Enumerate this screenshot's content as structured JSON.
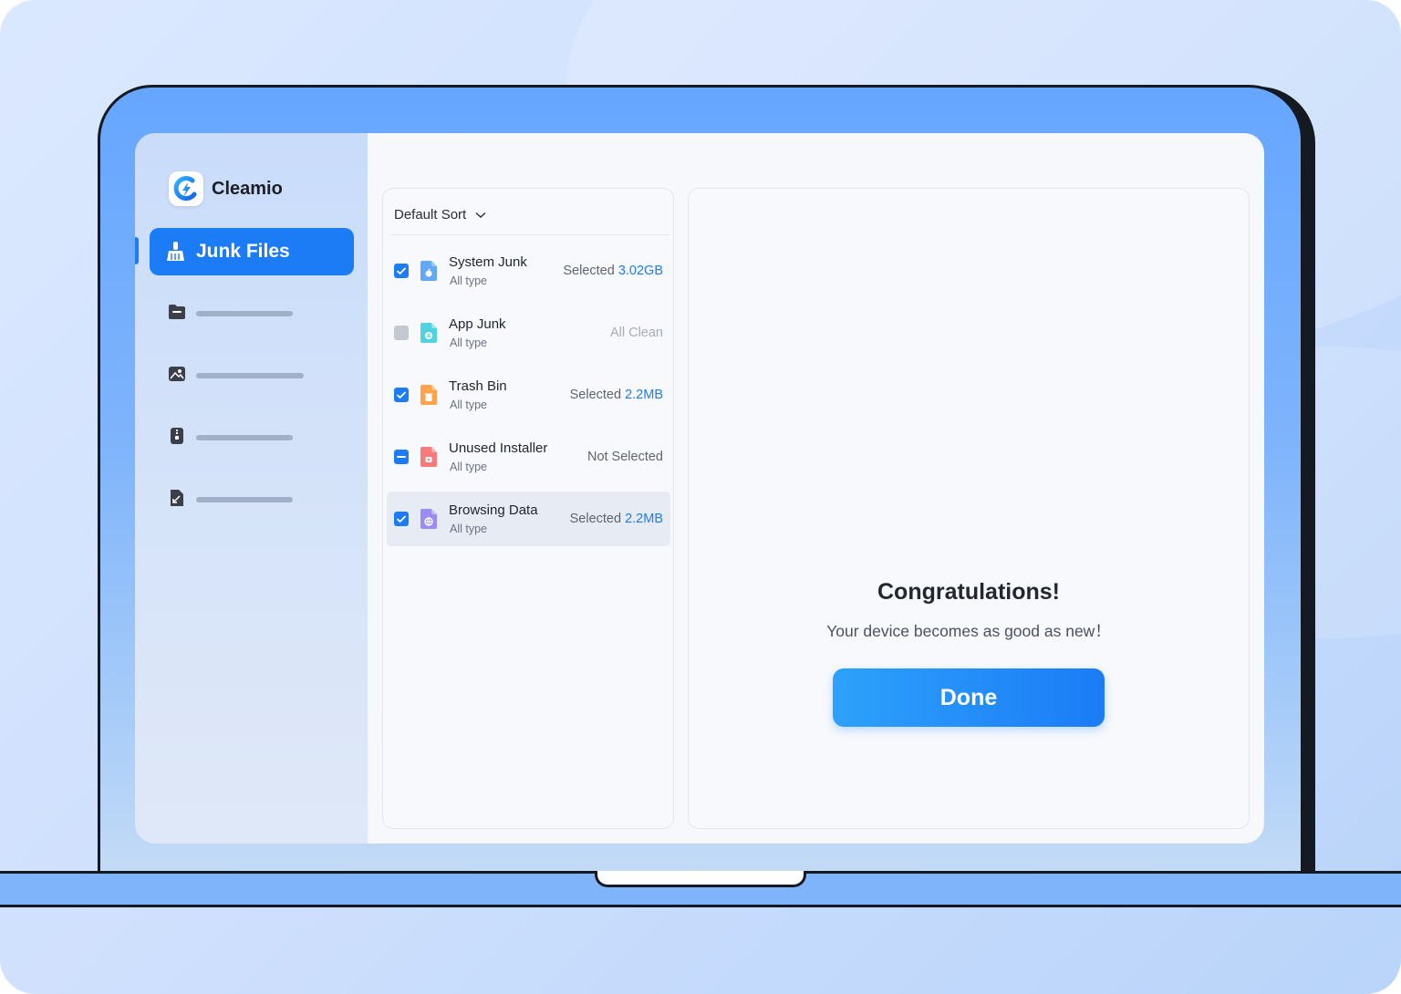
{
  "app": {
    "name": "Cleamio"
  },
  "colors": {
    "accent": "#1b7cf6",
    "disabled": "#c4c8cf"
  },
  "sidebar": {
    "active": {
      "label": "Junk Files",
      "icon": "broom-icon"
    },
    "items": [
      {
        "icon": "folder-icon"
      },
      {
        "icon": "photo-icon"
      },
      {
        "icon": "zip-archive-icon"
      },
      {
        "icon": "large-file-icon"
      }
    ]
  },
  "list": {
    "sort_label": "Default Sort",
    "items": [
      {
        "title": "System Junk",
        "subtitle": "All type",
        "status_prefix": "Selected",
        "status_value": "3.02GB",
        "checkbox": "checked",
        "icon": "apple-file-icon"
      },
      {
        "title": "App Junk",
        "subtitle": "All type",
        "status_text": "All Clean",
        "checkbox": "disabled",
        "icon": "app-store-file-icon"
      },
      {
        "title": "Trash Bin",
        "subtitle": "All type",
        "status_prefix": "Selected",
        "status_value": "2.2MB",
        "checkbox": "checked",
        "icon": "trash-file-icon"
      },
      {
        "title": "Unused Installer",
        "subtitle": "All type",
        "status_text": "Not Selected",
        "checkbox": "partial",
        "icon": "installer-file-icon"
      },
      {
        "title": "Browsing Data",
        "subtitle": "All type",
        "status_prefix": "Selected",
        "status_value": "2.2MB",
        "checkbox": "checked",
        "icon": "browser-file-icon"
      }
    ]
  },
  "result": {
    "title": "Congratulations!",
    "subtitle": "Your device becomes as good as new！",
    "button_label": "Done"
  }
}
